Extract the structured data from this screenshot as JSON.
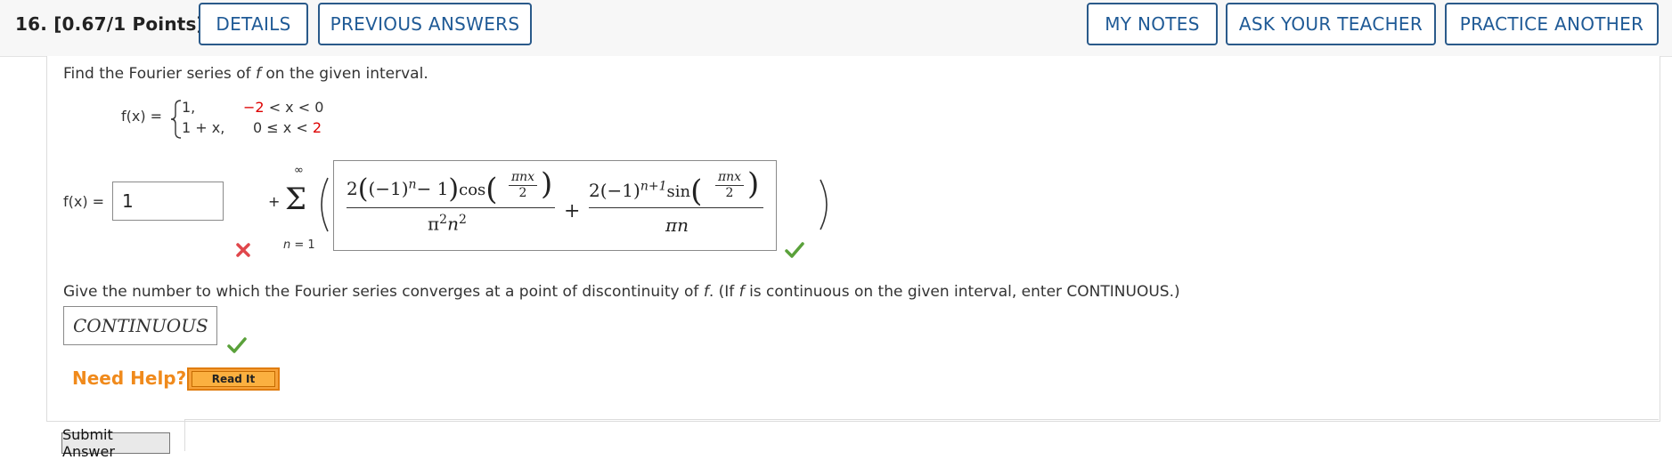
{
  "header": {
    "question_number": "16.",
    "points": "[0.67/1 Points]",
    "details_label": "DETAILS",
    "previous_answers_label": "PREVIOUS ANSWERS",
    "my_notes_label": "MY NOTES",
    "ask_teacher_label": "ASK YOUR TEACHER",
    "practice_another_label": "PRACTICE ANOTHER"
  },
  "problem": {
    "prompt": "Find the Fourier series of",
    "prompt_var": "f",
    "prompt_tail": "on the given interval.",
    "fx_label": "f(x) =",
    "piece1_value": "1,",
    "piece1_cond_lhs": "−2",
    "piece1_cond_rest": "< x < 0",
    "piece2_value": "1 + x,",
    "piece2_cond_rest": "0 ≤ x <",
    "piece2_cond_rhs": "2"
  },
  "answer1": {
    "fx_label": "f(x) =",
    "input_value": "1",
    "plus": "+",
    "sum_upper": "∞",
    "sum_lower": "n = 1",
    "sigma": "Σ"
  },
  "formula": {
    "num1_coef": "2",
    "num1_base": "(−1)",
    "num1_exp": "n",
    "num1_tail": "− 1",
    "cos": "cos",
    "arg_num": "πnx",
    "arg_den": "2",
    "den1": "π",
    "den1_exp1": "2",
    "den1_n": "n",
    "den1_exp2": "2",
    "plus": "+",
    "num2_coef": "2",
    "num2_base": "(−1)",
    "num2_exp": "n+1",
    "sin": "sin",
    "den2": "πn"
  },
  "question2": {
    "prompt_a": "Give the number to which the Fourier series converges at a point of discontinuity of",
    "var_f": "f",
    "prompt_b": ". (If",
    "prompt_c": "is continuous on the given interval, enter CONTINUOUS.)",
    "answer_value": "CONTINUOUS"
  },
  "help": {
    "need_help_label": "Need Help?",
    "read_it_label": "Read It"
  },
  "submit_label": "Submit Answer",
  "colors": {
    "accent_blue": "#1f5a96",
    "error_red": "#e0474c",
    "check_green": "#5aa13a",
    "help_orange": "#f08a1c"
  }
}
